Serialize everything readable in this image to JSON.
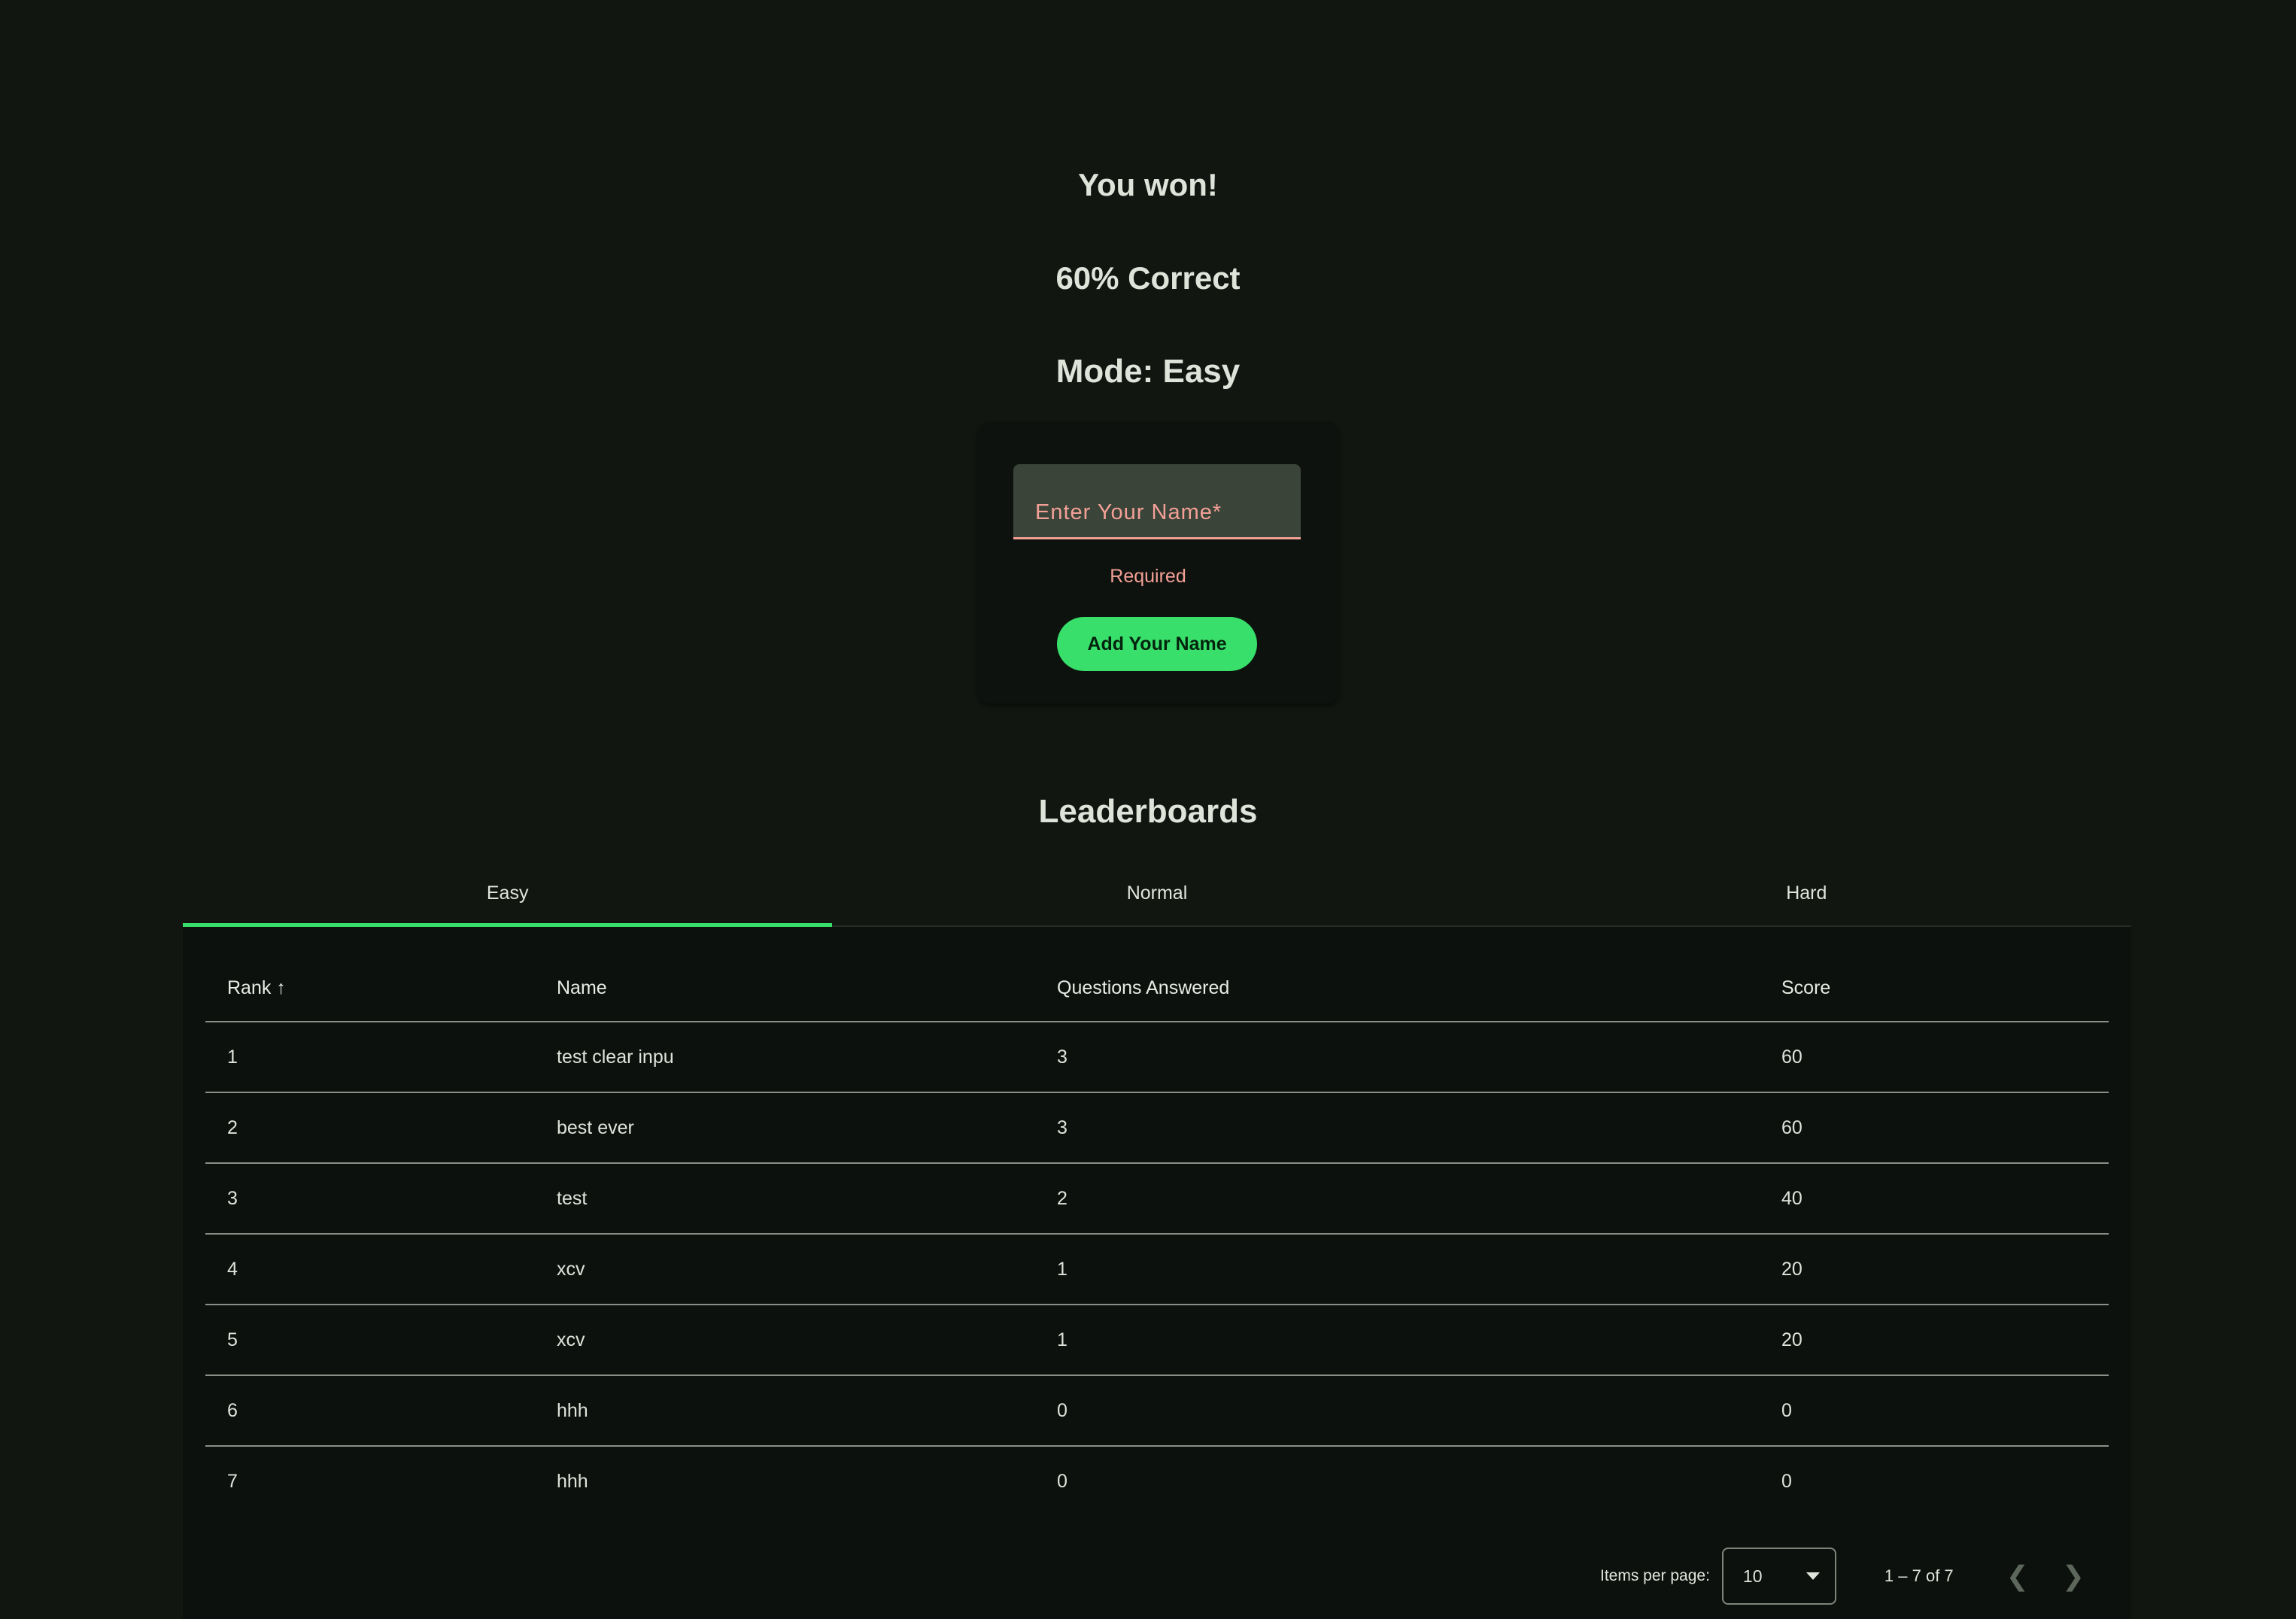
{
  "result": {
    "title": "You won!",
    "percent": "60% Correct",
    "mode": "Mode: Easy"
  },
  "form": {
    "placeholder": "Enter Your Name*",
    "error": "Required",
    "submit": "Add Your Name"
  },
  "leaderboard": {
    "title": "Leaderboards",
    "tabs": [
      "Easy",
      "Normal",
      "Hard"
    ],
    "active_tab": "Easy",
    "columns": [
      "Rank",
      "Name",
      "Questions Answered",
      "Score"
    ],
    "sort_icon": "arrow-up-icon",
    "rows": [
      [
        "1",
        "test clear inpu",
        "3",
        "60"
      ],
      [
        "2",
        "best ever",
        "3",
        "60"
      ],
      [
        "3",
        "test",
        "2",
        "40"
      ],
      [
        "4",
        "xcv",
        "1",
        "20"
      ],
      [
        "5",
        "xcv",
        "1",
        "20"
      ],
      [
        "6",
        "hhh",
        "0",
        "0"
      ],
      [
        "7",
        "hhh",
        "0",
        "0"
      ]
    ],
    "paginator": {
      "items_label": "Items per page:",
      "page_size": "10",
      "range": "1 – 7 of 7"
    }
  },
  "colors": {
    "accent": "#38df6a",
    "error": "#f3a097",
    "background": "#111611"
  }
}
